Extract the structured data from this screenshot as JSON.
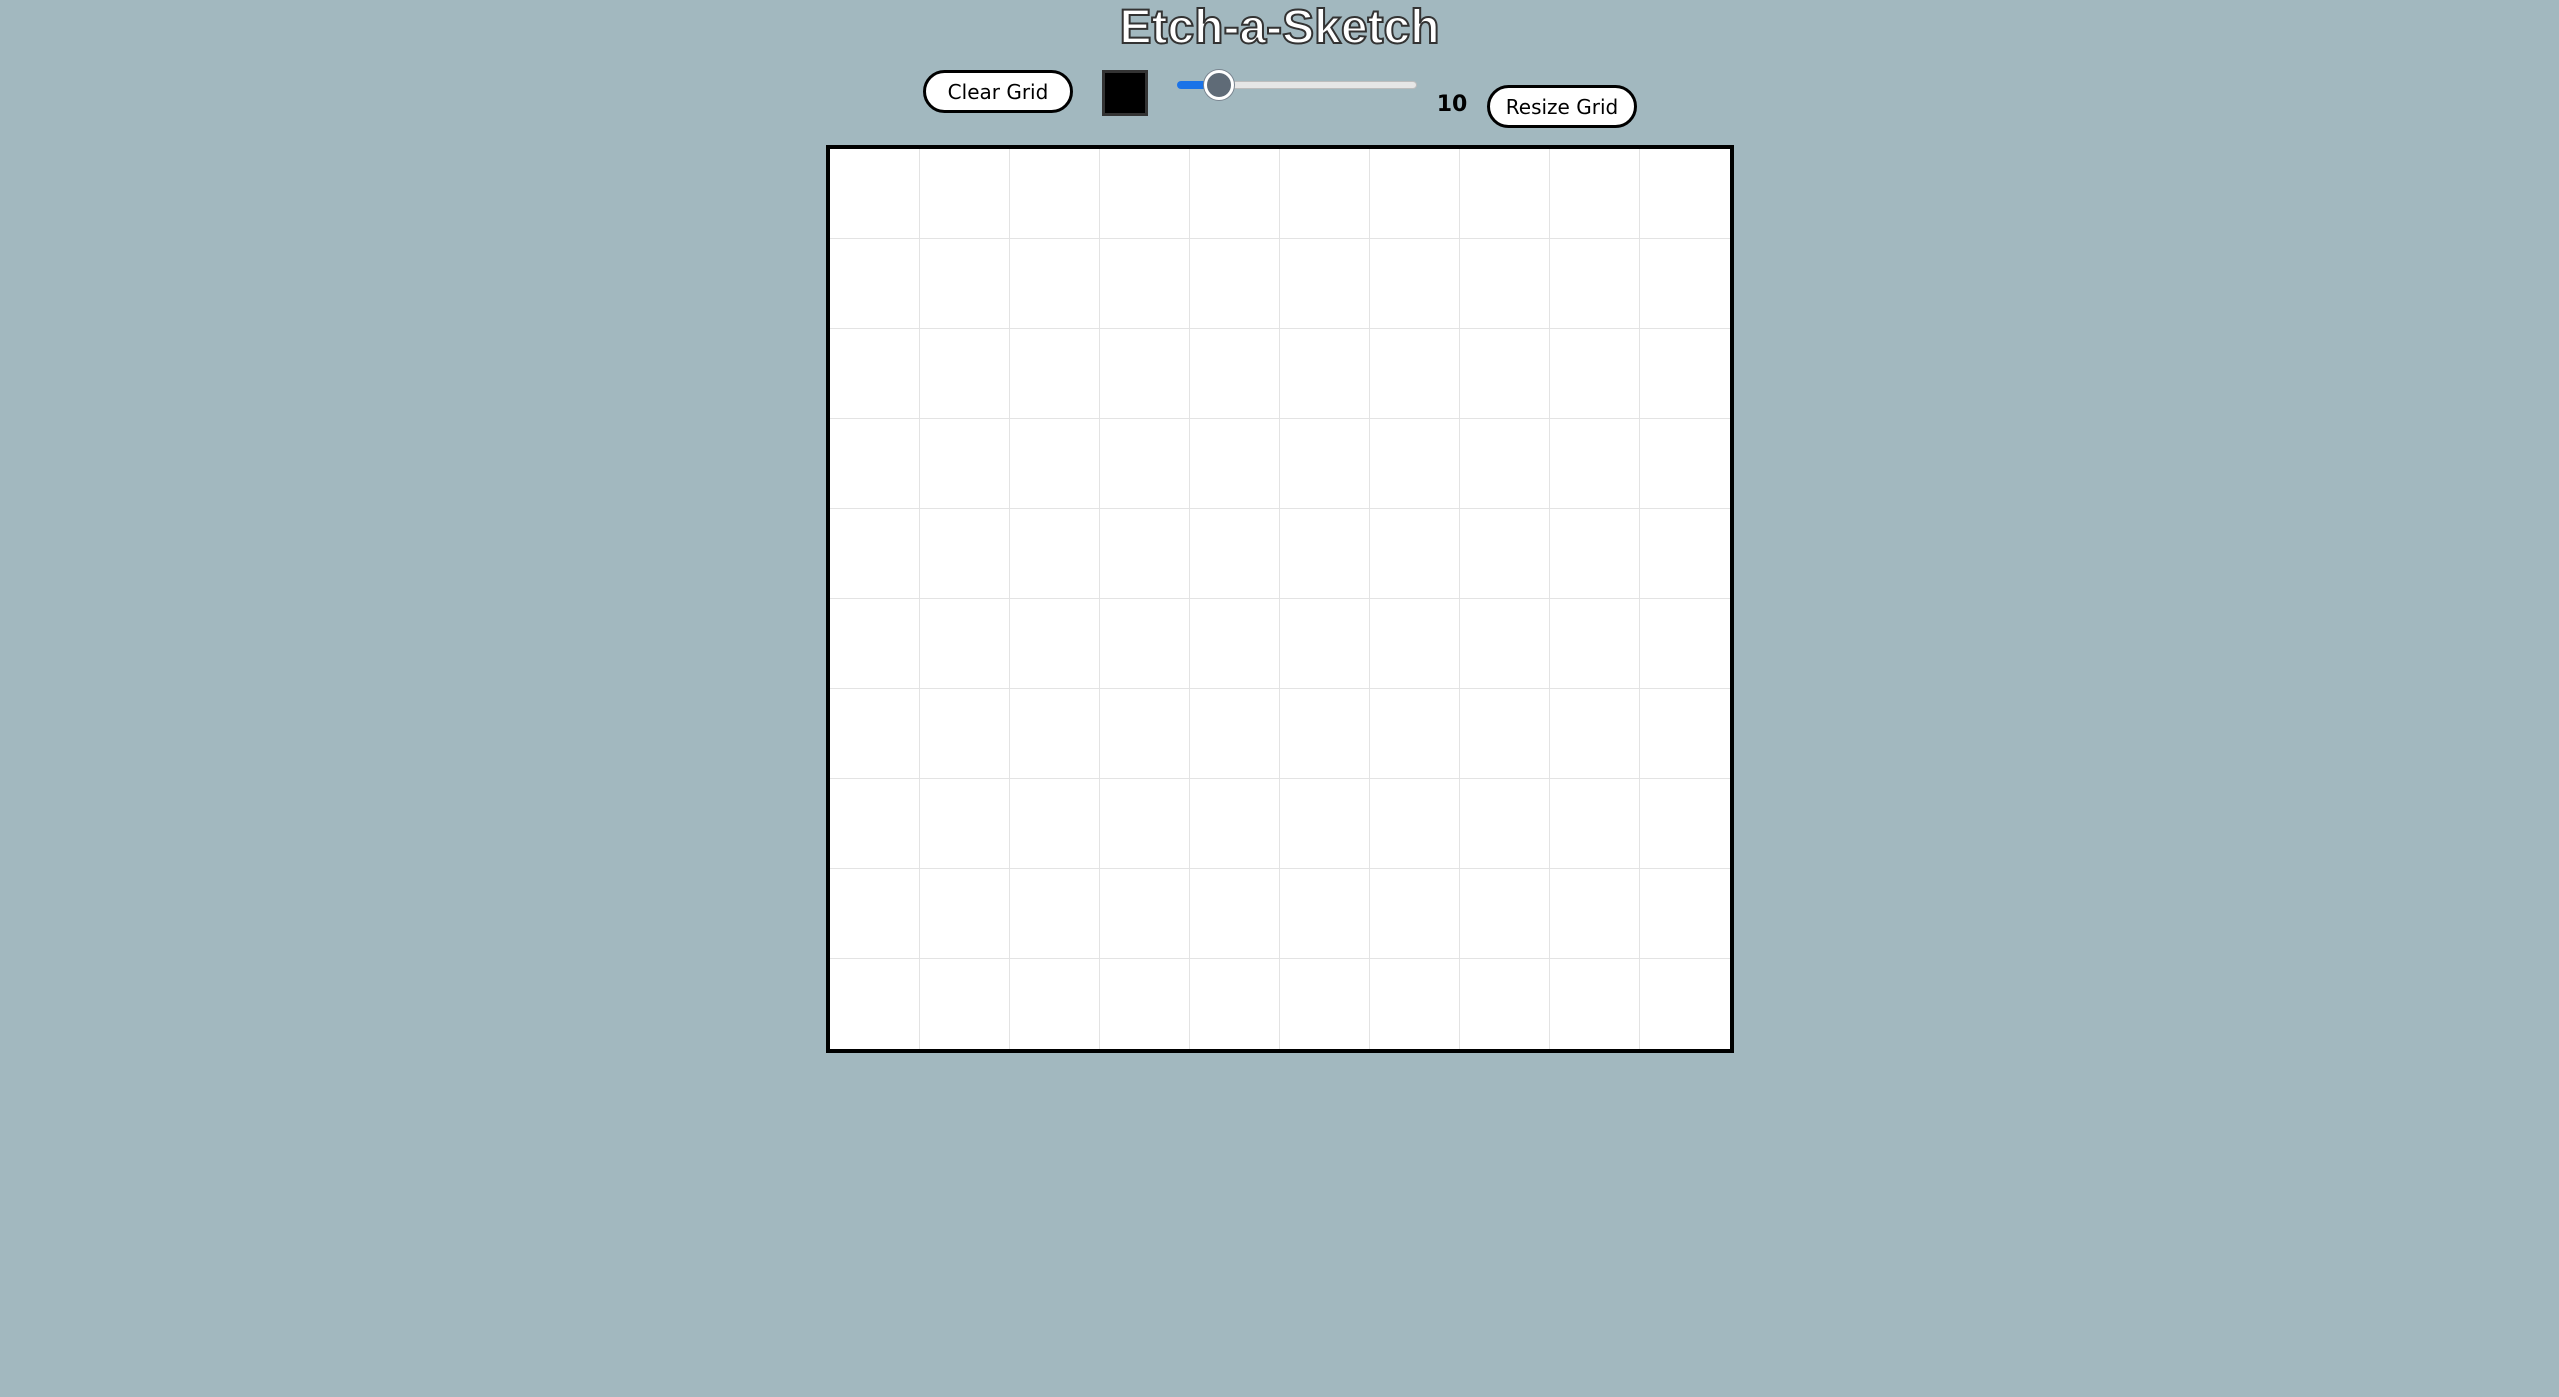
{
  "header": {
    "title": "Etch-a-Sketch"
  },
  "controls": {
    "clear_label": "Clear Grid",
    "resize_label": "Resize Grid",
    "color_picker": {
      "value": "#000000",
      "icon": "color-swatch-icon"
    },
    "size_slider": {
      "value": 10,
      "min": 1,
      "max": 100,
      "display": "10"
    }
  },
  "grid": {
    "rows": 10,
    "cols": 10,
    "cell_color": "#ffffff",
    "line_color": "#e3e3e3"
  },
  "colors": {
    "background": "#a2b8bf",
    "accent": "#1a73e8"
  }
}
